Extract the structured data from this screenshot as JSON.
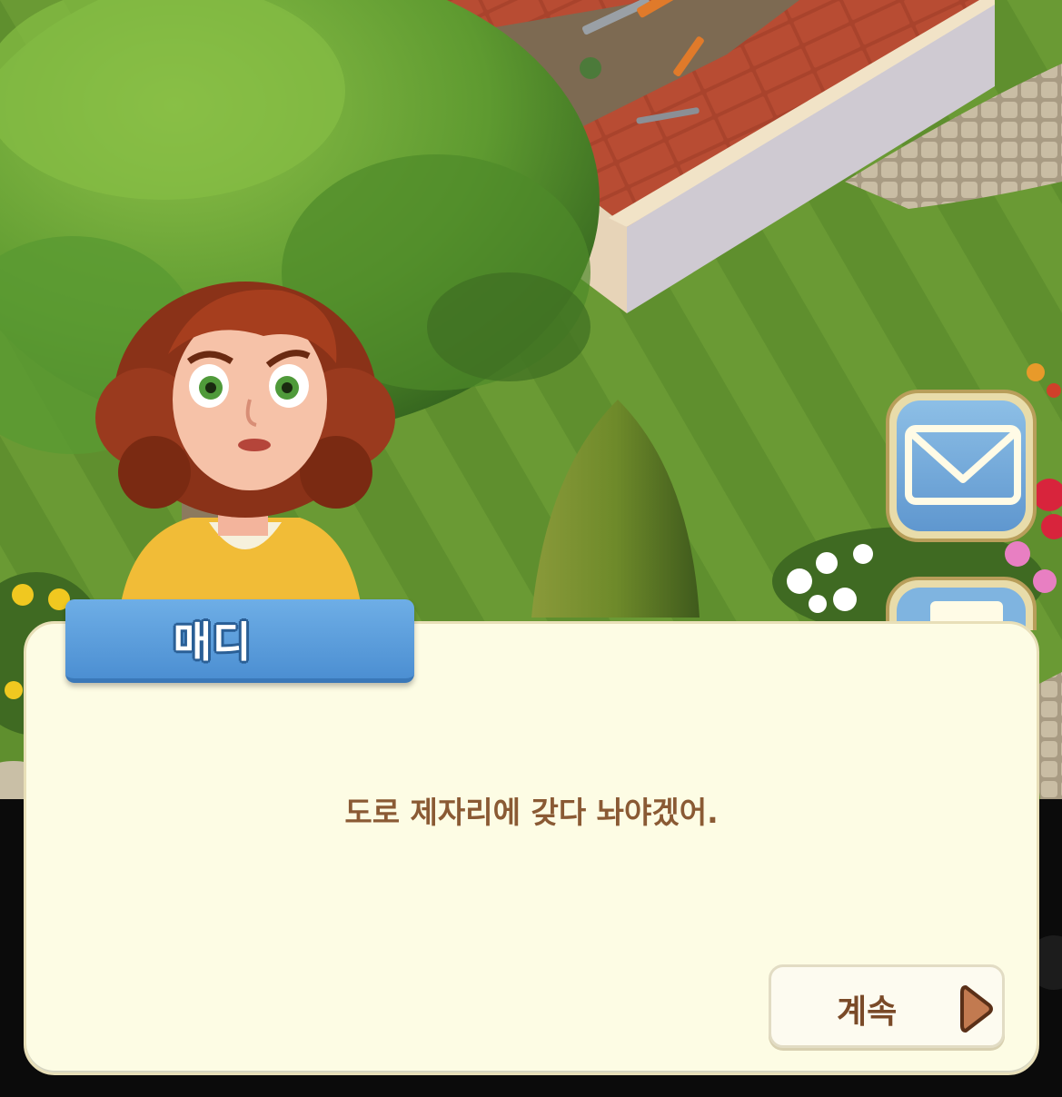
{
  "dialog": {
    "speaker": "매디",
    "text": "도로 제자리에 갖다 놔야겠어.",
    "continue_label": "계속"
  },
  "side_buttons": {
    "mail": "mail-icon"
  },
  "colors": {
    "panel_bg": "#fdfce4",
    "name_plate": "#5a9be0",
    "dialog_text": "#8a5a34",
    "continue_text": "#7a4a28",
    "arrow": "#c27a50"
  }
}
